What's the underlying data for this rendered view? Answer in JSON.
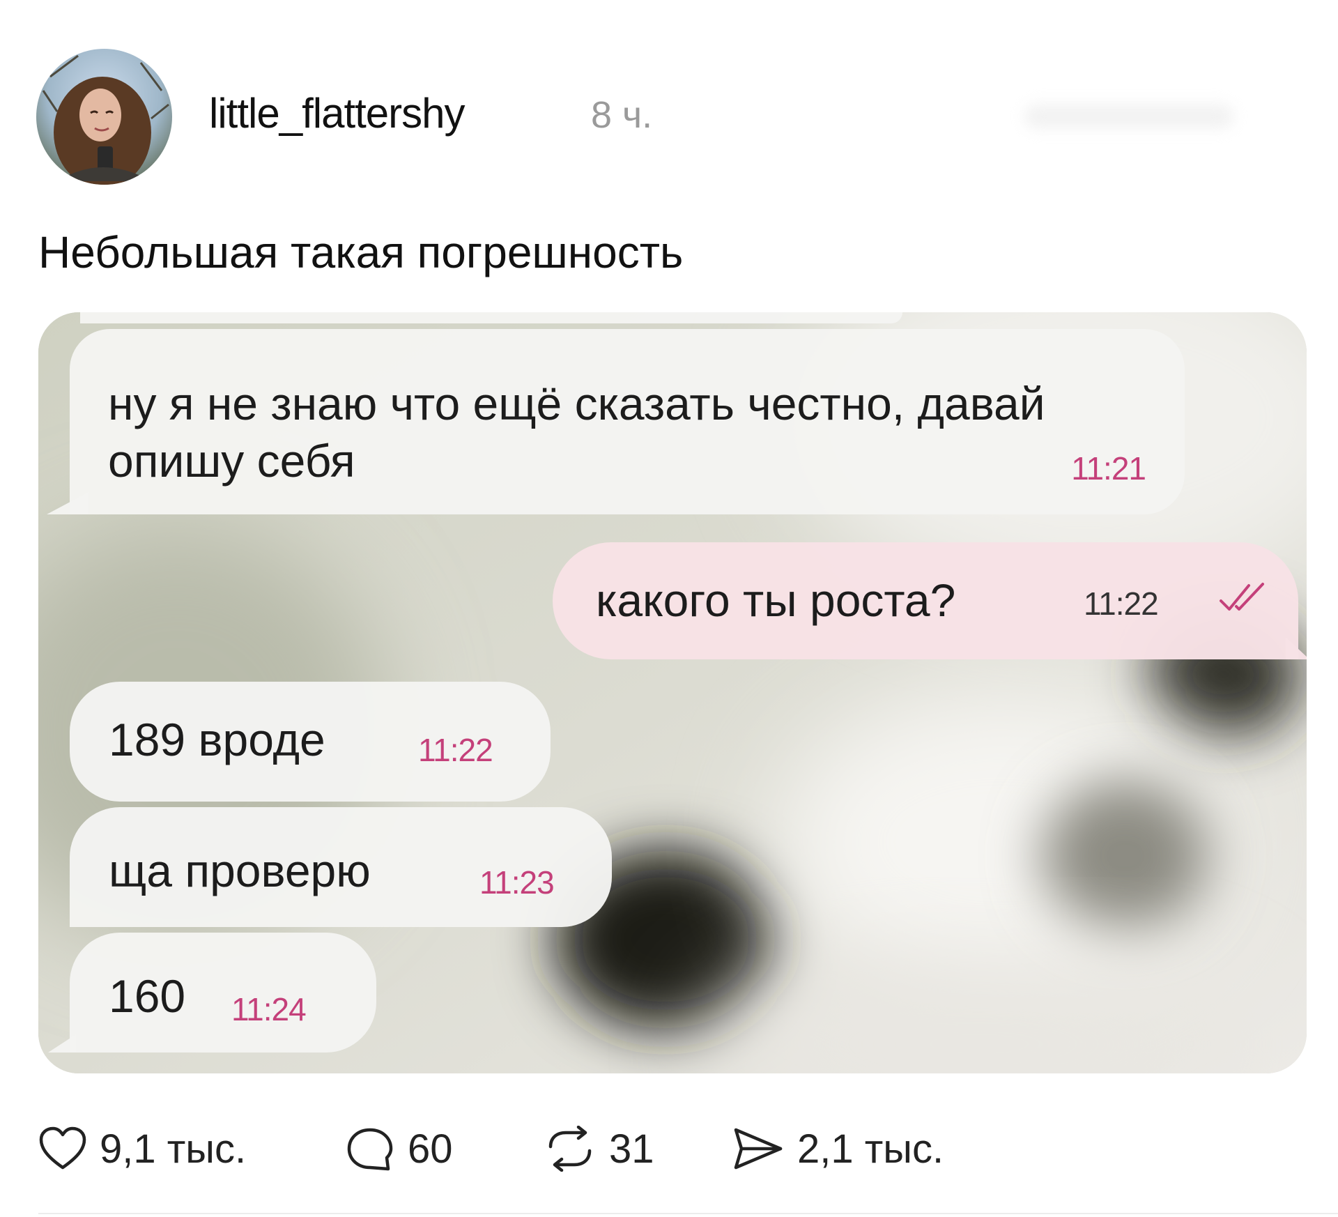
{
  "post": {
    "username": "little_flattershy",
    "time_ago": "8 ч.",
    "caption": "Небольшая такая погрешность"
  },
  "chat": {
    "messages": [
      {
        "direction": "incoming",
        "text": "ну я не знаю что ещё сказать честно, давай опишу себя",
        "time": "11:21"
      },
      {
        "direction": "outgoing",
        "text": "какого ты роста?",
        "time": "11:22",
        "status_icon": "double-check-icon"
      },
      {
        "direction": "incoming",
        "text": "189 вроде",
        "time": "11:22"
      },
      {
        "direction": "incoming",
        "text": "ща проверю",
        "time": "11:23"
      },
      {
        "direction": "incoming",
        "text": "160",
        "time": "11:24"
      }
    ]
  },
  "actions": {
    "likes": "9,1 тыс.",
    "replies": "60",
    "reposts": "31",
    "shares": "2,1 тыс."
  },
  "colors": {
    "timestamp": "#c4407a",
    "outgoing_bubble": "#f7e1e6",
    "incoming_bubble": "#f4f4f2",
    "muted_text": "#9a9a9a"
  }
}
